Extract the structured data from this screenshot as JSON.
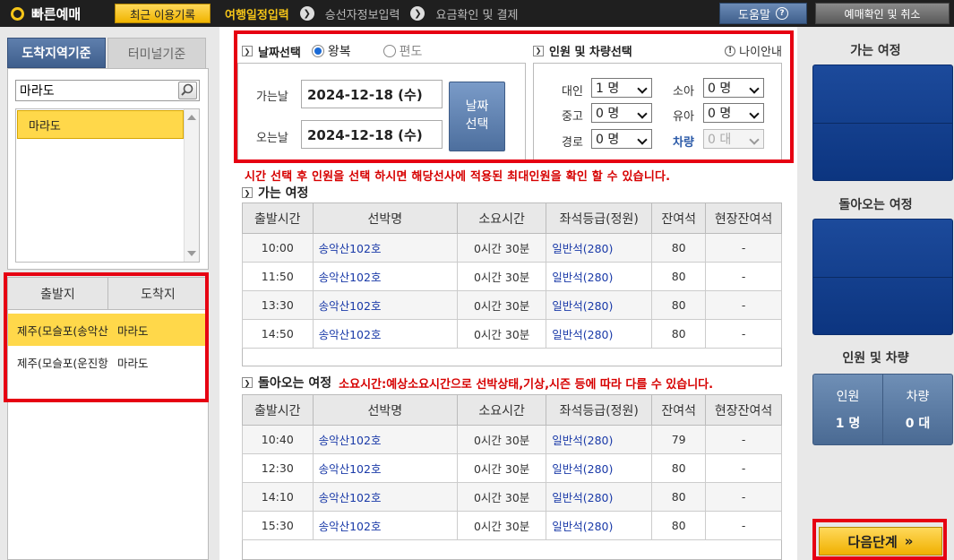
{
  "topbar": {
    "brand": "빠른예매",
    "recent_button": "최근 이용기록",
    "steps": [
      "여행일정입력",
      "승선자정보입력",
      "요금확인 및 결제"
    ],
    "help_button": "도움말",
    "confirm_button": "예매확인 및 취소"
  },
  "left": {
    "tab_active": "도착지역기준",
    "tab_inactive": "터미널기준",
    "search_value": "마라도",
    "list_items": [
      "마라도"
    ],
    "route_headers": [
      "출발지",
      "도착지"
    ],
    "routes": [
      {
        "from": "제주(모슬포(송악산))",
        "to": "마라도"
      },
      {
        "from": "제주(모슬포(운진항))",
        "to": "마라도"
      }
    ]
  },
  "date": {
    "title": "날짜선택",
    "option_round": "왕복",
    "option_oneway": "편도",
    "selected": "왕복",
    "depart_label": "가는날",
    "depart_value": "2024-12-18 (수)",
    "return_label": "오는날",
    "return_value": "2024-12-18 (수)",
    "date_button": "날짜\n선택"
  },
  "pax": {
    "title": "인원 및 차량선택",
    "age_info": "나이안내",
    "fields": [
      {
        "label": "대인",
        "value": "1 명"
      },
      {
        "label": "소아",
        "value": "0 명"
      },
      {
        "label": "중고",
        "value": "0 명"
      },
      {
        "label": "유아",
        "value": "0 명"
      },
      {
        "label": "경로",
        "value": "0 명"
      },
      {
        "label": "차량",
        "value": "0 대"
      }
    ]
  },
  "notice": "시간 선택 후 인원을 선택 하시면 해당선사에 적용된 최대인원을 확인 할 수 있습니다.",
  "outbound": {
    "title": "가는 여정",
    "headers": [
      "출발시간",
      "선박명",
      "소요시간",
      "좌석등급(정원)",
      "잔여석",
      "현장잔여석"
    ],
    "rows": [
      [
        "10:00",
        "송악산102호",
        "0시간 30분",
        "일반석(280)",
        "80",
        "-"
      ],
      [
        "11:50",
        "송악산102호",
        "0시간 30분",
        "일반석(280)",
        "80",
        "-"
      ],
      [
        "13:30",
        "송악산102호",
        "0시간 30분",
        "일반석(280)",
        "80",
        "-"
      ],
      [
        "14:50",
        "송악산102호",
        "0시간 30분",
        "일반석(280)",
        "80",
        "-"
      ]
    ]
  },
  "inbound": {
    "title": "돌아오는 여정",
    "note": "소요시간:예상소요시간으로 선박상태,기상,시즌 등에 따라 다를 수 있습니다.",
    "headers": [
      "출발시간",
      "선박명",
      "소요시간",
      "좌석등급(정원)",
      "잔여석",
      "현장잔여석"
    ],
    "rows": [
      [
        "10:40",
        "송악산102호",
        "0시간 30분",
        "일반석(280)",
        "79",
        "-"
      ],
      [
        "12:30",
        "송악산102호",
        "0시간 30분",
        "일반석(280)",
        "80",
        "-"
      ],
      [
        "14:10",
        "송악산102호",
        "0시간 30분",
        "일반석(280)",
        "80",
        "-"
      ],
      [
        "15:30",
        "송악산102호",
        "0시간 30분",
        "일반석(280)",
        "80",
        "-"
      ]
    ]
  },
  "right": {
    "outbound_title": "가는 여정",
    "return_title": "돌아오는 여정",
    "summary_title": "인원 및 차량",
    "people_label": "인원",
    "people_value": "1 명",
    "vehicle_label": "차량",
    "vehicle_value": "0 대",
    "next_button": "다음단계"
  }
}
